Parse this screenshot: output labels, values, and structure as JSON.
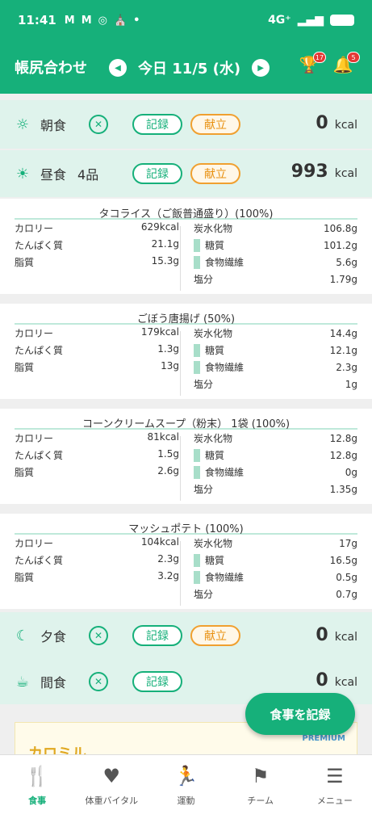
{
  "status": {
    "time": "11:41",
    "icons": [
      "M",
      "M",
      "◎",
      "⛪",
      "•"
    ],
    "network": "4G⁺",
    "signal": "▂▄▆"
  },
  "header": {
    "title": "帳尻合わせ",
    "date": "今日 11/5 (水)",
    "trophy_badge": "17",
    "bell_badge": "5"
  },
  "meals": [
    {
      "id": "breakfast",
      "icon": "sunrise-icon",
      "glyph": "☼",
      "name": "朝食",
      "count": "",
      "record_label": "記録",
      "menu_label": "献立",
      "kcal": "0",
      "unit": "kcal",
      "has_menu": true
    },
    {
      "id": "lunch",
      "icon": "sun-icon",
      "glyph": "☀",
      "name": "昼食",
      "count": "4品",
      "record_label": "記録",
      "menu_label": "献立",
      "kcal": "993",
      "unit": "kcal",
      "has_menu": true,
      "no_eat": false
    },
    {
      "id": "dinner",
      "icon": "moon-icon",
      "glyph": "☾",
      "name": "夕食",
      "count": "",
      "record_label": "記録",
      "menu_label": "献立",
      "kcal": "0",
      "unit": "kcal",
      "has_menu": true
    },
    {
      "id": "snack",
      "icon": "cup-icon",
      "glyph": "☕",
      "name": "間食",
      "count": "",
      "record_label": "記録",
      "menu_label": "",
      "kcal": "0",
      "unit": "kcal",
      "has_menu": false
    }
  ],
  "foods": [
    {
      "name": "タコライス（ご飯普通盛り）(100%)",
      "kcal": "629kcal",
      "protein": "21.1g",
      "fat": "15.3g",
      "carbs": "106.8g",
      "sugar": "101.2g",
      "fiber": "5.6g",
      "salt": "1.79g"
    },
    {
      "name": "ごぼう唐揚げ (50%)",
      "kcal": "179kcal",
      "protein": "1.3g",
      "fat": "13g",
      "carbs": "14.4g",
      "sugar": "12.1g",
      "fiber": "2.3g",
      "salt": "1g"
    },
    {
      "name": "コーンクリームスープ（粉末） 1袋 (100%)",
      "kcal": "81kcal",
      "protein": "1.5g",
      "fat": "2.6g",
      "carbs": "12.8g",
      "sugar": "12.8g",
      "fiber": "0g",
      "salt": "1.35g"
    },
    {
      "name": "マッシュポテト (100%)",
      "kcal": "104kcal",
      "protein": "2.3g",
      "fat": "3.2g",
      "carbs": "17g",
      "sugar": "16.5g",
      "fiber": "0.5g",
      "salt": "0.7g"
    }
  ],
  "labels": {
    "calorie": "カロリー",
    "protein": "たんぱく質",
    "fat": "脂質",
    "carbs": "炭水化物",
    "sugar": "糖質",
    "fiber": "食物繊維",
    "salt": "塩分"
  },
  "fab": {
    "label": "食事を記録"
  },
  "banner": {
    "logo": "カロミル",
    "premium": "PREMIUM"
  },
  "tabs": [
    {
      "id": "meal",
      "label": "食事",
      "glyph": "🍴",
      "active": true
    },
    {
      "id": "weight",
      "label": "体重バイタル",
      "glyph": "♥",
      "active": false
    },
    {
      "id": "exercise",
      "label": "運動",
      "glyph": "🏃",
      "active": false
    },
    {
      "id": "team",
      "label": "チーム",
      "glyph": "⚑",
      "active": false
    },
    {
      "id": "menu",
      "label": "メニュー",
      "glyph": "☰",
      "active": false
    }
  ],
  "colors": {
    "brand": "#16b07a",
    "accent_orange": "#f0a030",
    "badge_red": "#e53935"
  }
}
